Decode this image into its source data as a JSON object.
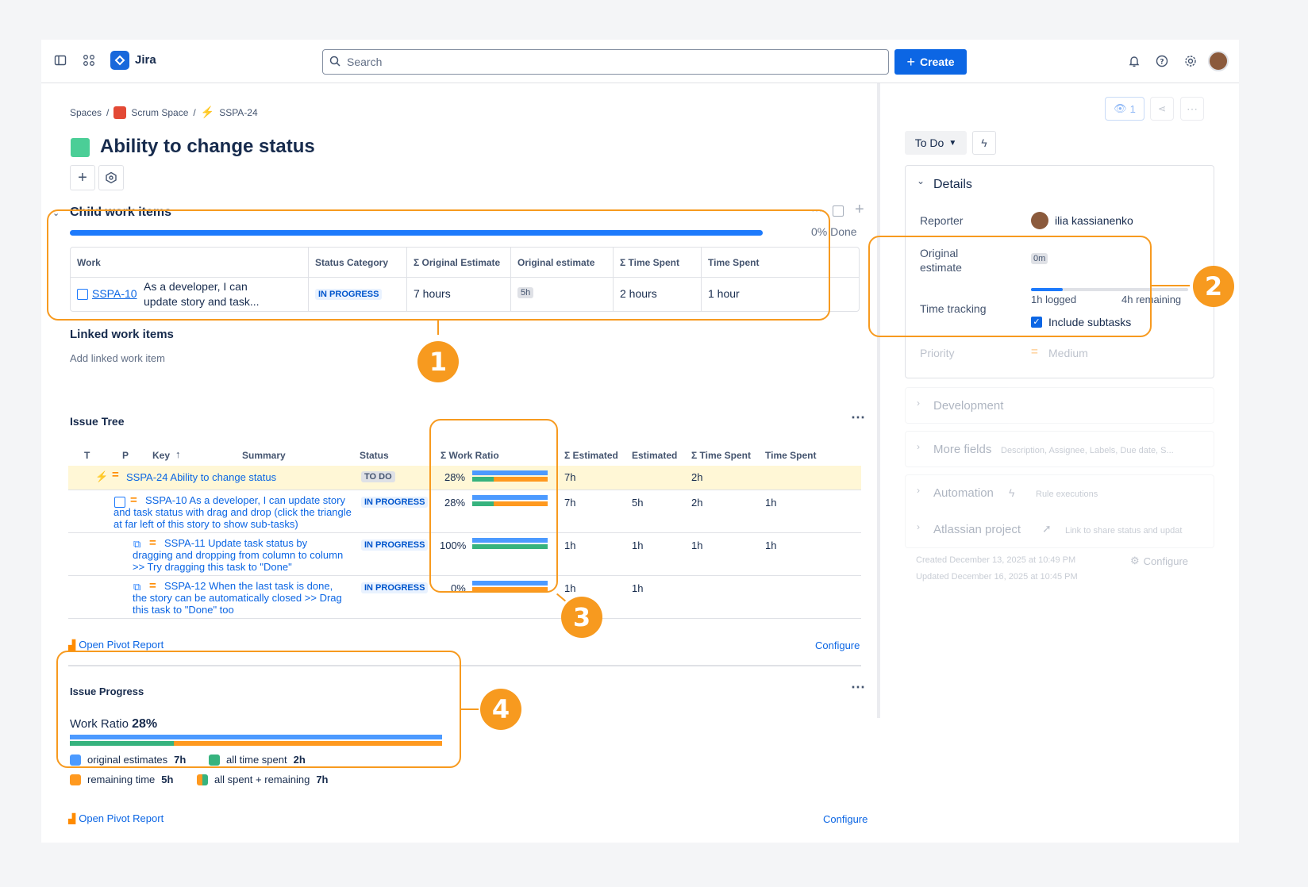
{
  "topbar": {
    "app_name": "Jira",
    "search_placeholder": "Search",
    "create_label": "Create"
  },
  "breadcrumb": {
    "spaces": "Spaces",
    "project": "Scrum Space",
    "issue_key": "SSPA-24",
    "sep": "/"
  },
  "issue": {
    "title": "Ability to change status"
  },
  "child_items": {
    "heading": "Child work items",
    "progress_done_label": "0% Done",
    "progress_fraction": 0,
    "columns": [
      "Work",
      "Status Category",
      "Σ Original Estimate",
      "Original estimate",
      "Σ Time Spent",
      "Time Spent"
    ],
    "row": {
      "key": "SSPA-10",
      "summary": "As a developer, I can update story and task...",
      "status": "IN PROGRESS",
      "sum_original_estimate": "7 hours",
      "original_estimate": "5h",
      "sum_time_spent": "2 hours",
      "time_spent": "1 hour"
    }
  },
  "linked": {
    "heading": "Linked work items",
    "add_label": "Add linked work item"
  },
  "issue_tree": {
    "heading": "Issue Tree",
    "columns": {
      "t": "T",
      "p": "P",
      "key": "Key",
      "summary": "Summary",
      "status": "Status",
      "work_ratio": "Σ Work Ratio",
      "sum_estimated": "Σ Estimated",
      "estimated": "Estimated",
      "sum_time_spent": "Σ Time Spent",
      "time_spent": "Time Spent"
    },
    "rows": [
      {
        "text": "SSPA-24 Ability to change status",
        "status": "TO DO",
        "ratio": "28%",
        "ratio_value": 0.28,
        "sum_est": "7h",
        "est": "",
        "sum_spent": "2h",
        "spent": ""
      },
      {
        "text": "SSPA-10 As a developer, I can update story and task status with drag and drop (click the triangle at far left of this story to show sub-tasks)",
        "status": "IN PROGRESS",
        "ratio": "28%",
        "ratio_value": 0.28,
        "sum_est": "7h",
        "est": "5h",
        "sum_spent": "2h",
        "spent": "1h"
      },
      {
        "text": "SSPA-11 Update task status by dragging and dropping from column to column >> Try dragging this task to \"Done\"",
        "status": "IN PROGRESS",
        "ratio": "100%",
        "ratio_value": 1.0,
        "sum_est": "1h",
        "est": "1h",
        "sum_spent": "1h",
        "spent": "1h"
      },
      {
        "text": "SSPA-12 When the last task is done, the story can be automatically closed >> Drag this task to \"Done\" too",
        "status": "IN PROGRESS",
        "ratio": "0%",
        "ratio_value": 0,
        "sum_est": "1h",
        "est": "1h",
        "sum_spent": "",
        "spent": ""
      }
    ],
    "pivot_link": "Open Pivot Report",
    "configure": "Configure"
  },
  "issue_progress": {
    "heading": "Issue Progress",
    "work_ratio_label": "Work Ratio",
    "work_ratio_value": "28%",
    "legend": {
      "original": "original estimates",
      "original_val": "7h",
      "spent": "all time spent",
      "spent_val": "2h",
      "remaining": "remaining time",
      "remaining_val": "5h",
      "all": "all spent + remaining",
      "all_val": "7h"
    },
    "pivot_link": "Open Pivot Report",
    "configure": "Configure"
  },
  "sidebar": {
    "watch_count": "1",
    "status_button": "To Do",
    "details_heading": "Details",
    "reporter_label": "Reporter",
    "reporter_name": "ilia kassianenko",
    "original_estimate_label": "Original estimate",
    "original_estimate_value": "0m",
    "time_tracking_label": "Time tracking",
    "logged": "1h logged",
    "remaining": "4h remaining",
    "logged_fraction": 0.2,
    "include_subtasks": "Include subtasks",
    "priority_label": "Priority",
    "priority_value": "Medium",
    "development": "Development",
    "more_fields": "More fields",
    "more_fields_hint": "Description, Assignee, Labels, Due date, S...",
    "automation": "Automation",
    "rule_executions": "Rule executions",
    "atlassian_project": "Atlassian project",
    "atlassian_hint": "Link to share status and updat",
    "created": "Created December 13, 2025 at 10:49 PM",
    "updated": "Updated December 16, 2025 at 10:45 PM",
    "configure": "Configure"
  },
  "callouts": [
    "1",
    "2",
    "3",
    "4"
  ],
  "colors": {
    "accent": "#0C66E4",
    "callout": "#F79A1F",
    "blue_bar": "#4C9AFF",
    "green_bar": "#36B37E",
    "orange_bar": "#FF991F"
  }
}
